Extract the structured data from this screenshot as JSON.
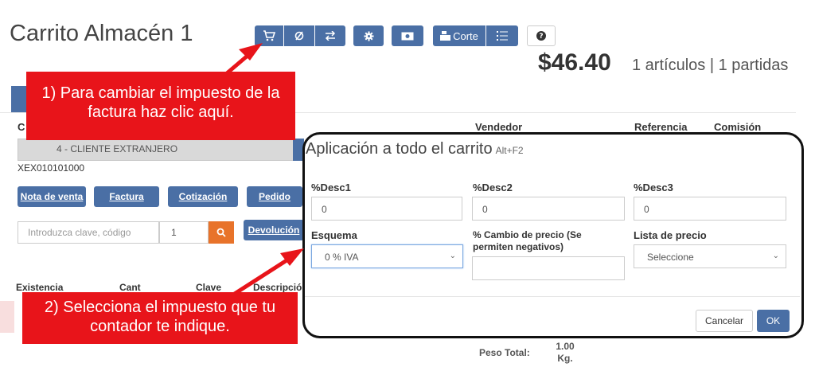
{
  "header": {
    "title": "Carrito Almacén 1",
    "corte_label": "Corte",
    "total": "$46.40",
    "total_summary": "1 artículos | 1 partidas"
  },
  "form": {
    "client_label": "C",
    "client_value": "4 - CLIENTE EXTRANJERO",
    "rfc": "XEX010101000",
    "vendedor_label": "Vendedor",
    "referencia_label": "Referencia",
    "comision_label": "Comisión",
    "buttons": {
      "nota": "Nota de venta",
      "factura": "Factura",
      "cotizacion": "Cotización",
      "pedido": "Pedido",
      "devolucion": "Devolución"
    },
    "search_placeholder": "Introduzca clave, código",
    "quantity": "1"
  },
  "table": {
    "headers": [
      "Existencia",
      "Cant",
      "Clave",
      "Descripción"
    ]
  },
  "footer": {
    "peso_label": "Peso Total:",
    "peso_value": "1.00",
    "peso_unit": "Kg."
  },
  "modal": {
    "title": "Aplicación a todo el carrito",
    "shortcut": "Alt+F2",
    "desc1_label": "%Desc1",
    "desc1_value": "0",
    "desc2_label": "%Desc2",
    "desc2_value": "0",
    "desc3_label": "%Desc3",
    "desc3_value": "0",
    "esquema_label": "Esquema",
    "esquema_value": "0 % IVA",
    "cambio_label": "% Cambio de precio (Se permiten negativos)",
    "lista_label": "Lista de precio",
    "lista_value": "Seleccione",
    "cancel_label": "Cancelar",
    "ok_label": "OK"
  },
  "callouts": {
    "step1": "1) Para cambiar el impuesto de la factura haz clic aquí.",
    "step2": "2) Selecciona el impuesto que tu contador te indique."
  },
  "colors": {
    "primary": "#4a6fa5",
    "search": "#e8732a",
    "callout": "#e8141a"
  }
}
